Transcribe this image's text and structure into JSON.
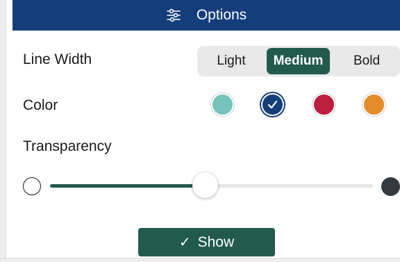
{
  "header": {
    "title": "Options",
    "icon": "sliders-icon"
  },
  "line_width": {
    "label": "Line Width",
    "options": [
      "Light",
      "Medium",
      "Bold"
    ],
    "selected": "Medium"
  },
  "color": {
    "label": "Color",
    "swatches": [
      {
        "name": "teal",
        "hex": "#75c3ba",
        "selected": false
      },
      {
        "name": "navy",
        "hex": "#163e7a",
        "selected": true
      },
      {
        "name": "red",
        "hex": "#bd1e3e",
        "selected": false
      },
      {
        "name": "orange",
        "hex": "#e48c2a",
        "selected": false
      }
    ]
  },
  "transparency": {
    "label": "Transparency",
    "value_fraction": 0.48
  },
  "show_button": {
    "check": "✓",
    "label": "Show"
  },
  "colors": {
    "header_bg": "#143d7c",
    "accent": "#225a4d"
  }
}
